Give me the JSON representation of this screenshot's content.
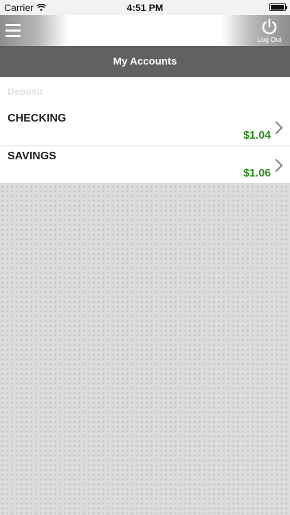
{
  "status_bar": {
    "carrier": "Carrier",
    "time": "4:51 PM",
    "battery_level": 1.0
  },
  "toolbar": {
    "menu_icon": "hamburger-icon",
    "logout_icon": "power-icon",
    "logout_label": "Log Out"
  },
  "header": {
    "title": "My Accounts"
  },
  "accounts": {
    "section_label": "Deposit",
    "items": [
      {
        "name": "CHECKING",
        "balance": "$1.04"
      },
      {
        "name": "SAVINGS",
        "balance": "$1.06"
      }
    ]
  },
  "colors": {
    "title_bar": "#616161",
    "balance_green": "#2e8b1f",
    "pattern_bg": "#dcdcdc"
  }
}
